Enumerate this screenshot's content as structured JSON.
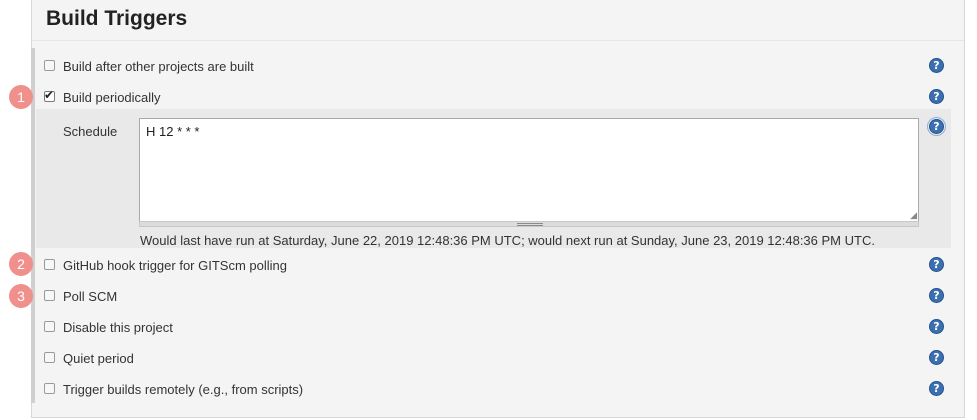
{
  "section": {
    "title": "Build Triggers"
  },
  "triggers": [
    {
      "label": "Build after other projects are built",
      "checked": false,
      "badge": ""
    },
    {
      "label": "Build periodically",
      "checked": true,
      "badge": "1"
    },
    {
      "label": "GitHub hook trigger for GITScm polling",
      "checked": false,
      "badge": "2"
    },
    {
      "label": "Poll SCM",
      "checked": false,
      "badge": "3"
    },
    {
      "label": "Disable this project",
      "checked": false,
      "badge": ""
    },
    {
      "label": "Quiet period",
      "checked": false,
      "badge": ""
    },
    {
      "label": "Trigger builds remotely (e.g., from scripts)",
      "checked": false,
      "badge": ""
    }
  ],
  "schedule": {
    "label": "Schedule",
    "value": "H 12 * * *",
    "info": "Would last have run at Saturday, June 22, 2019 12:48:36 PM UTC; would next run at Sunday, June 23, 2019 12:48:36 PM UTC."
  },
  "help_glyph": "?",
  "icons": {
    "help": "help-circle-icon",
    "check": "checkmark-icon"
  },
  "colors": {
    "help_icon": "#3c6fb0",
    "badge": "#f0908c",
    "panel": "#f4f4f4",
    "schedule_band": "#e9e9e9"
  }
}
